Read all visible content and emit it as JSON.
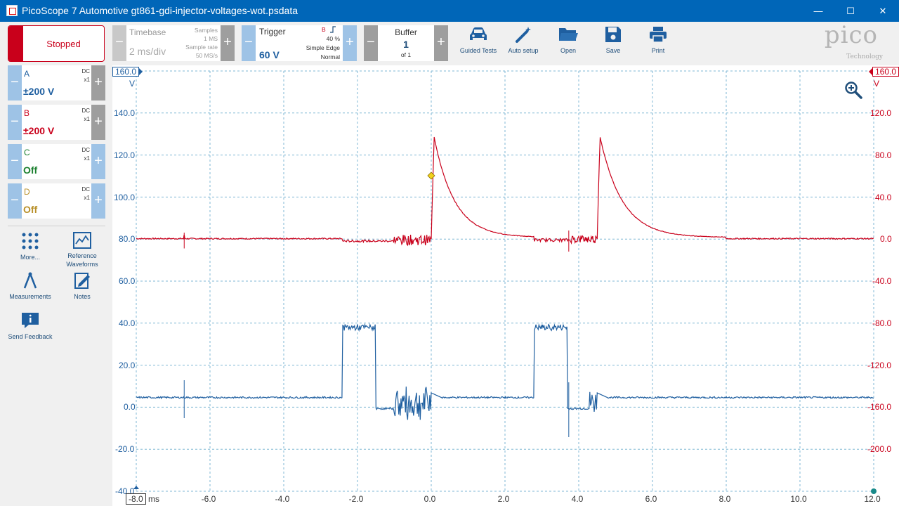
{
  "window": {
    "title": "PicoScope 7 Automotive gt861-gdi-injector-voltages-wot.psdata",
    "minimize": "—",
    "maximize": "☐",
    "close": "✕"
  },
  "toolbar": {
    "stop_label": "Stopped",
    "timebase": {
      "label": "Timebase",
      "value": "2 ms/div",
      "samples_label": "Samples",
      "samples_value": "1 MS",
      "rate_label": "Sample rate",
      "rate_value": "50 MS/s"
    },
    "trigger": {
      "label": "Trigger",
      "value": "60 V",
      "channel": "B",
      "percent": "40 %",
      "type": "Simple Edge",
      "mode": "Normal"
    },
    "buffer": {
      "label": "Buffer",
      "value": "1",
      "of": "of 1"
    },
    "minus": "−",
    "plus": "+",
    "tools": [
      {
        "label": "Guided Tests",
        "icon": "car-icon"
      },
      {
        "label": "Auto setup",
        "icon": "magic-wand-icon"
      },
      {
        "label": "Open",
        "icon": "folder-icon"
      },
      {
        "label": "Save",
        "icon": "floppy-disk-icon"
      },
      {
        "label": "Print",
        "icon": "printer-icon"
      }
    ],
    "logo": {
      "word": "pico",
      "sub": "Technology"
    }
  },
  "channels": [
    {
      "name": "A",
      "coupling": "DC",
      "probe": "x1",
      "range": "±200 V",
      "color": "#1f5fa0"
    },
    {
      "name": "B",
      "coupling": "DC",
      "probe": "x1",
      "range": "±200 V",
      "color": "#c9001b"
    },
    {
      "name": "C",
      "coupling": "DC",
      "probe": "x1",
      "range": "Off",
      "color": "#1a7f2e"
    },
    {
      "name": "D",
      "coupling": "DC",
      "probe": "x1",
      "range": "Off",
      "color": "#b8902a"
    }
  ],
  "side_tools": [
    {
      "label": "More...",
      "icon": "dots-grid-icon"
    },
    {
      "label": "Reference Waveforms",
      "icon": "reference-waveform-icon"
    },
    {
      "label": "Measurements",
      "icon": "measurements-icon"
    },
    {
      "label": "Notes",
      "icon": "notes-icon"
    },
    {
      "label": "Send Feedback",
      "icon": "feedback-icon"
    }
  ],
  "plot": {
    "left_axis": {
      "top_label": "160.0",
      "unit": "V",
      "ticks": [
        "140.0",
        "120.0",
        "100.0",
        "80.0",
        "60.0",
        "40.0",
        "20.0",
        "0.0",
        "-20.0",
        "-40.0"
      ]
    },
    "right_axis": {
      "top_label": "160.0",
      "unit": "V",
      "ticks": [
        "120.0",
        "80.0",
        "40.0",
        "0.0",
        "-40.0",
        "-80.0",
        "-120.0",
        "-160.0",
        "-200.0"
      ]
    },
    "x_axis": {
      "first_label": "-8.0",
      "unit": "ms",
      "ticks": [
        "-6.0",
        "-4.0",
        "-2.0",
        "0.0",
        "2.0",
        "4.0",
        "6.0",
        "8.0",
        "10.0",
        "12.0"
      ]
    },
    "colors": {
      "channel_a": "#1f5fa0",
      "channel_b": "#c9001b",
      "grid": "#7fb7d4",
      "trigger_marker": "#f2d21b"
    },
    "zoom_icon": "zoom-in-icon"
  }
}
